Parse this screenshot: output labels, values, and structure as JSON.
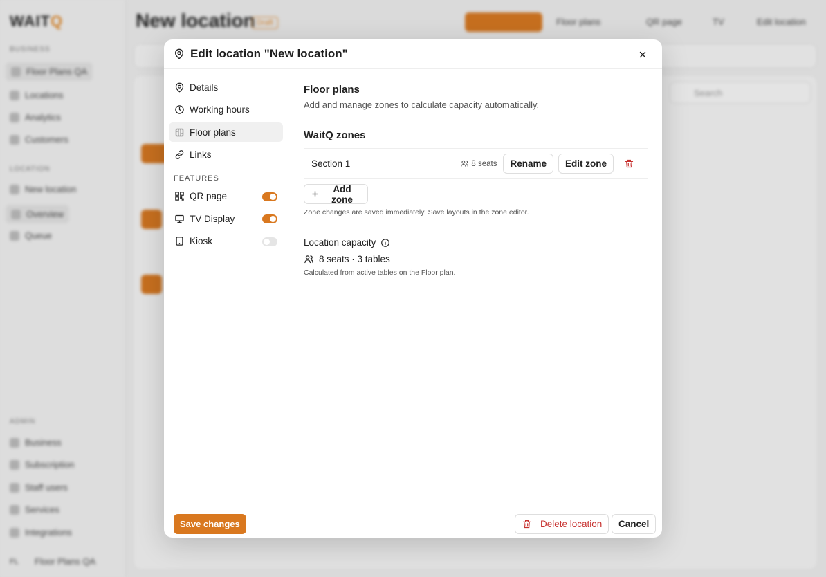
{
  "background": {
    "logo_main": "WAIT",
    "logo_accent": "Q",
    "sections": [
      "BUSINESS",
      "LOCATION",
      "ADMIN"
    ],
    "items": [
      "Floor Plans QA",
      "Locations",
      "Analytics",
      "Customers",
      "New location",
      "Overview",
      "Queue",
      "Business",
      "Subscription",
      "Staff users",
      "Services",
      "Integrations"
    ],
    "footer_user": "Floor Plans QA",
    "footer_initials": "FL",
    "page_title": "New location",
    "page_badge": "Draft",
    "top_links": [
      "Floor plans",
      "QR page",
      "TV",
      "Edit location"
    ],
    "search_placeholder": "Search"
  },
  "modal": {
    "title": "Edit location \"New location\"",
    "nav": {
      "items": [
        {
          "label": "Details",
          "icon": "map-pin-icon"
        },
        {
          "label": "Working hours",
          "icon": "clock-icon"
        },
        {
          "label": "Floor plans",
          "icon": "floor-plan-icon",
          "active": true
        },
        {
          "label": "Links",
          "icon": "link-icon"
        }
      ],
      "features_heading": "FEATURES",
      "features": [
        {
          "label": "QR page",
          "icon": "qr-code-icon",
          "enabled": true
        },
        {
          "label": "TV Display",
          "icon": "monitor-icon",
          "enabled": true
        },
        {
          "label": "Kiosk",
          "icon": "tablet-icon",
          "enabled": false
        }
      ]
    },
    "content": {
      "title": "Floor plans",
      "subtitle": "Add and manage zones to calculate capacity automatically.",
      "zones_heading": "WaitQ zones",
      "zones": [
        {
          "name": "Section 1",
          "seats": "8 seats",
          "rename_label": "Rename",
          "edit_label": "Edit zone"
        }
      ],
      "add_zone_label": "Add zone",
      "zone_note": "Zone changes are saved immediately. Save layouts in the zone editor.",
      "capacity_title": "Location capacity",
      "capacity_value": "8 seats · 3 tables",
      "capacity_note": "Calculated from active tables on the Floor plan."
    },
    "footer": {
      "save_label": "Save changes",
      "delete_label": "Delete location",
      "cancel_label": "Cancel"
    }
  },
  "colors": {
    "accent": "#d9781f",
    "danger": "#c7312f"
  }
}
